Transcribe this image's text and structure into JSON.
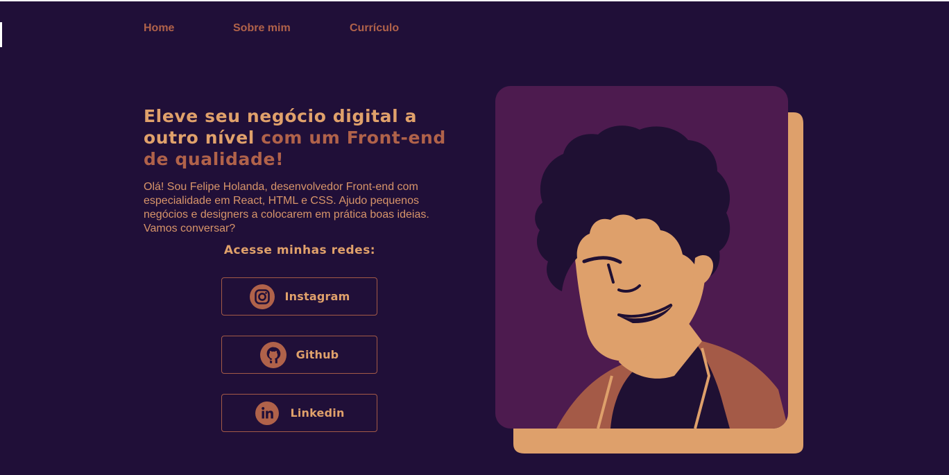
{
  "nav": {
    "items": [
      {
        "label": "Home"
      },
      {
        "label": "Sobre mim"
      },
      {
        "label": "Currículo"
      }
    ]
  },
  "hero": {
    "title_part1": "Eleve seu negócio digital a outro nível ",
    "title_part2": "com um Front-end de qualidade!",
    "intro": "Olá! Sou Felipe Holanda, desenvolvedor Front-end com especialidade em React, HTML e CSS. Ajudo pequenos negócios e designers a colocarem em prática boas ideias. Vamos conversar?"
  },
  "networks": {
    "title": "Acesse minhas redes:",
    "items": [
      {
        "label": "Instagram",
        "icon": "instagram-icon"
      },
      {
        "label": "Github",
        "icon": "github-icon"
      },
      {
        "label": "Linkedin",
        "icon": "linkedin-icon"
      }
    ]
  },
  "colors": {
    "background": "#200f38",
    "accent": "#b0624a",
    "highlight": "#e0a16b",
    "card_purple": "#4d1b4f"
  }
}
